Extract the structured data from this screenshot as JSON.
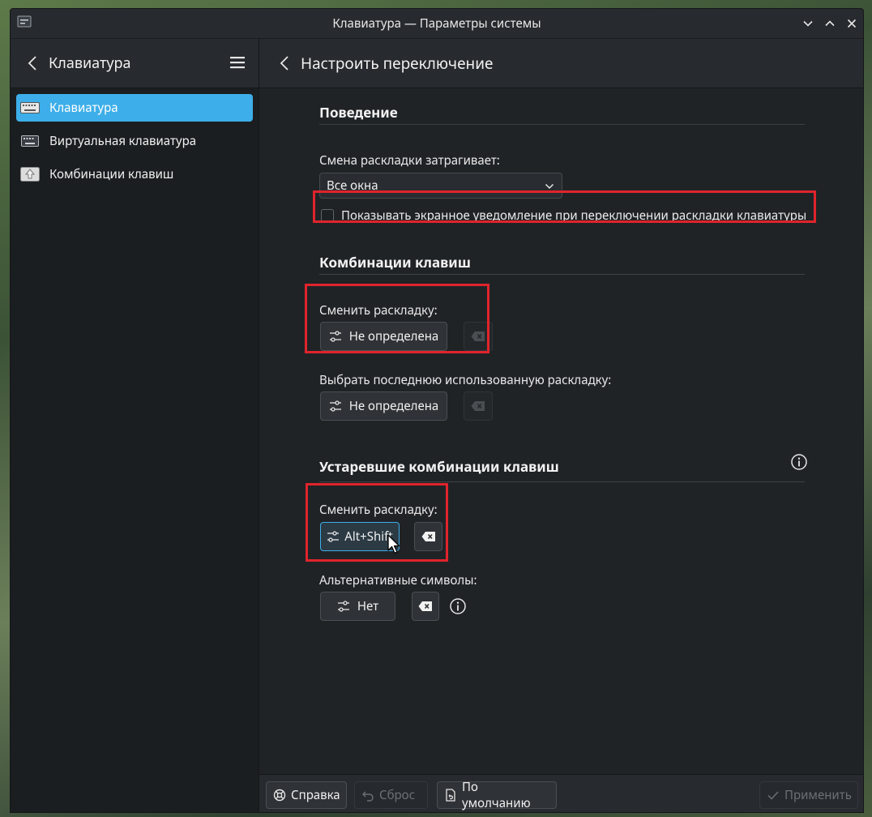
{
  "window": {
    "title": "Клавиатура — Параметры системы"
  },
  "sidebar": {
    "header_title": "Клавиатура",
    "items": [
      {
        "label": "Клавиатура",
        "icon": "keyboard-icon",
        "active": true
      },
      {
        "label": "Виртуальная клавиатура",
        "icon": "virtual-keyboard-icon",
        "active": false
      },
      {
        "label": "Комбинации клавиш",
        "icon": "shortcuts-icon",
        "active": false
      }
    ]
  },
  "main": {
    "header_title": "Настроить переключение",
    "behavior": {
      "title": "Поведение",
      "switch_affects_label": "Смена раскладки затрагивает:",
      "switch_affects_value": "Все окна",
      "osd_checkbox_label": "Показывать экранное уведомление при переключении раскладки клавиатуры",
      "osd_checked": false
    },
    "shortcuts": {
      "title": "Комбинации клавиш",
      "switch_layout_label": "Сменить раскладку:",
      "switch_layout_value": "Не определена",
      "last_layout_label": "Выбрать последнюю использованную раскладку:",
      "last_layout_value": "Не определена"
    },
    "legacy": {
      "title": "Устаревшие комбинации клавиш",
      "switch_layout_label": "Сменить раскладку:",
      "switch_layout_value": "Alt+Shift",
      "alt_symbols_label": "Альтернативные символы:",
      "alt_symbols_value": "Нет"
    }
  },
  "footer": {
    "help_label": "Справка",
    "reset_label": "Сброс",
    "defaults_label": "По умолчанию",
    "apply_label": "Применить"
  },
  "colors": {
    "accent": "#3daee9",
    "highlight_box": "#e0242c",
    "window_bg": "#202326"
  }
}
